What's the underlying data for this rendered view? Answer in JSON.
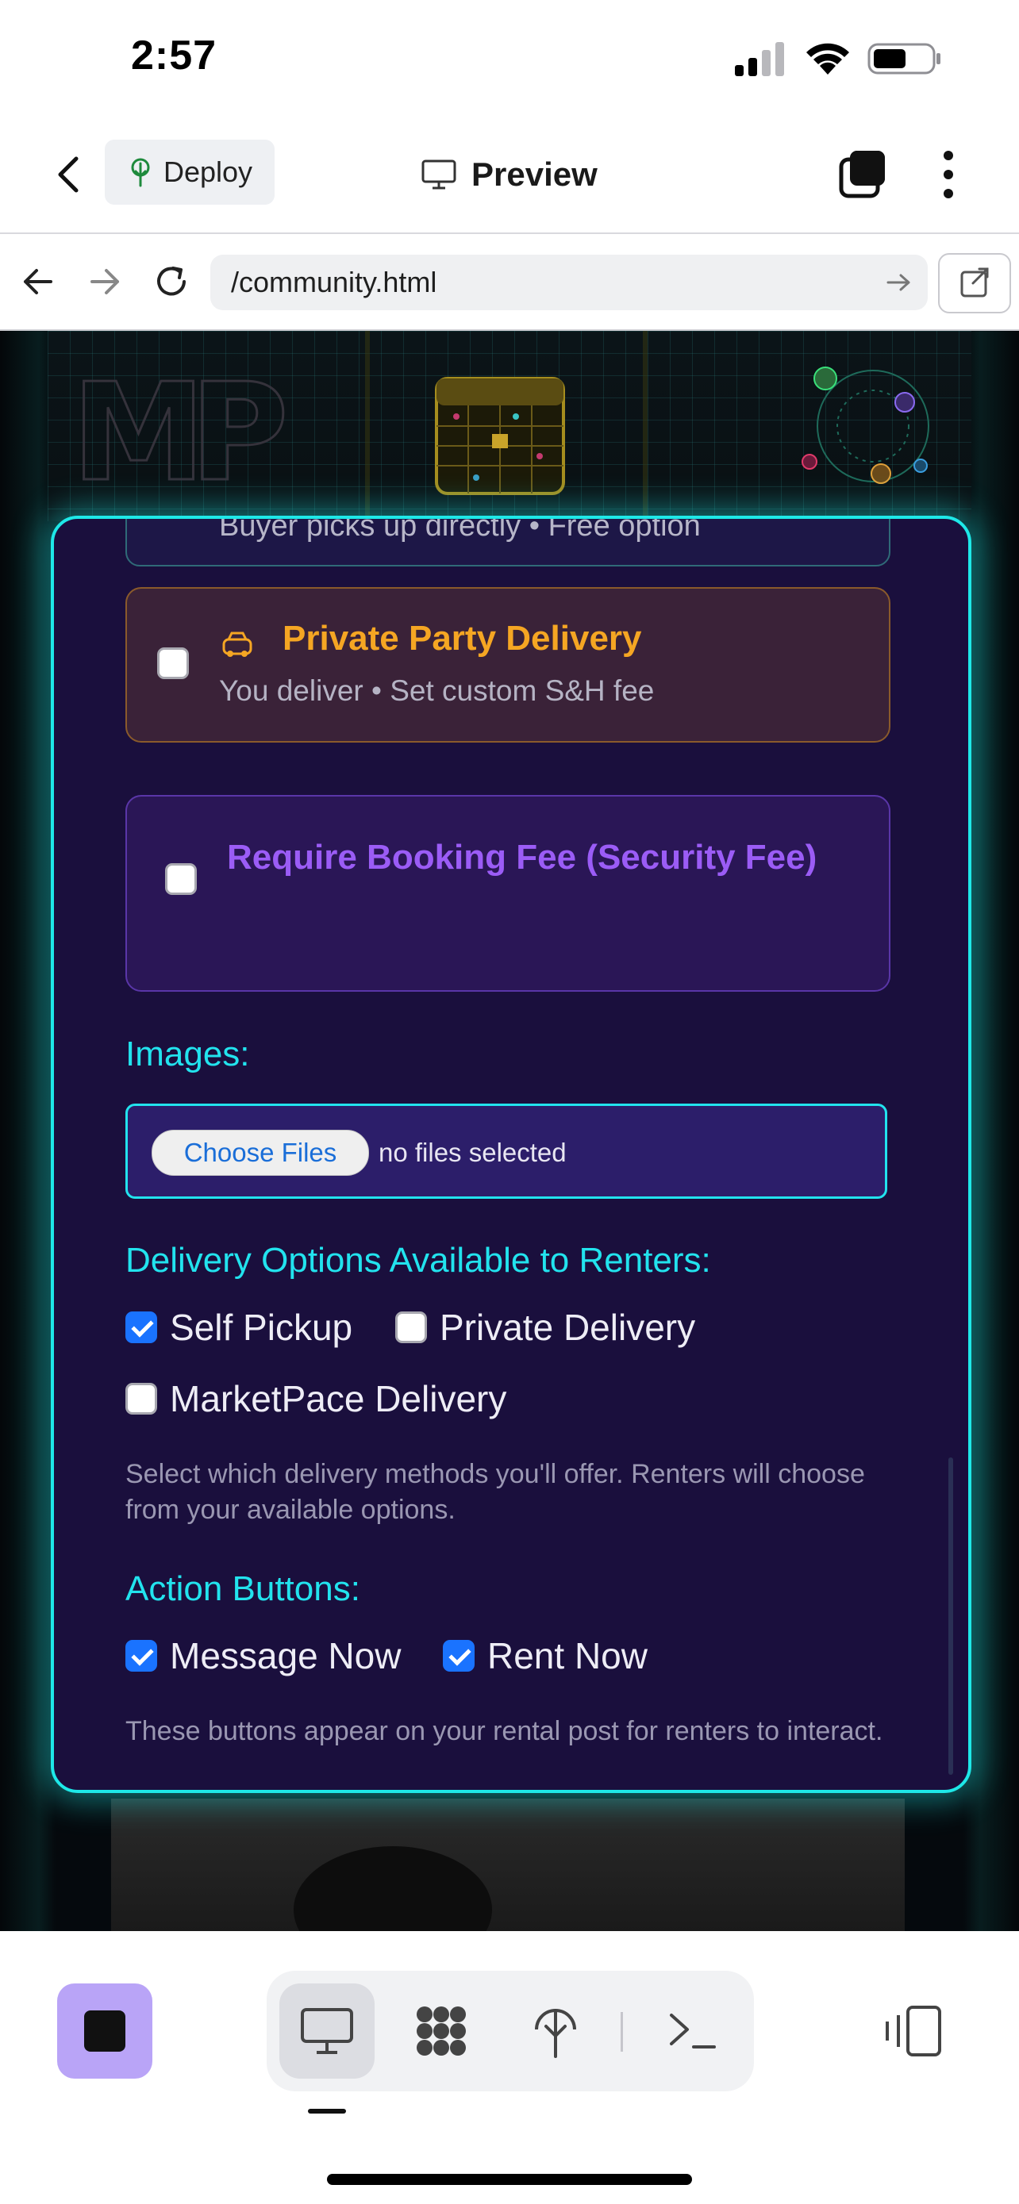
{
  "status_bar": {
    "time": "2:57"
  },
  "header": {
    "deploy_label": "Deploy",
    "preview_label": "Preview"
  },
  "browser": {
    "url": "/community.html"
  },
  "form": {
    "pickup_card_text": "Buyer picks up directly • Free option",
    "private_party": {
      "title": "Private Party Delivery",
      "subtitle": "You deliver • Set custom S&H fee",
      "checked": false
    },
    "booking_fee": {
      "title": "Require Booking Fee (Security Fee)",
      "checked": false
    },
    "images": {
      "label": "Images:",
      "choose_button": "Choose Files",
      "status": "no files selected"
    },
    "delivery": {
      "label": "Delivery Options Available to Renters:",
      "options": [
        {
          "label": "Self Pickup",
          "checked": true
        },
        {
          "label": "Private Delivery",
          "checked": false
        },
        {
          "label": "MarketPace Delivery",
          "checked": false
        }
      ],
      "help": "Select which delivery methods you'll offer. Renters will choose from your available options."
    },
    "actions": {
      "label": "Action Buttons:",
      "options": [
        {
          "label": "Message Now",
          "checked": true
        },
        {
          "label": "Rent Now",
          "checked": true
        }
      ],
      "help": "These buttons appear on your rental post for renters to interact."
    }
  },
  "colors": {
    "accent_cyan": "#1ee8e8",
    "orange": "#f5a623",
    "purple": "#9b5cf6",
    "modal_bg": "#1a0f3d"
  },
  "bottom_tabs": [
    "monitor-icon",
    "grid-icon",
    "deploy-icon",
    "terminal-icon"
  ]
}
